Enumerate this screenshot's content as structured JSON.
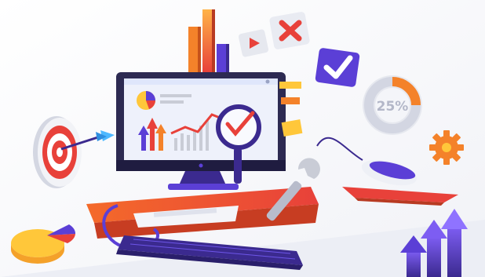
{
  "illustration": {
    "subject": "digital-marketing-analytics",
    "donut_label": "25%",
    "donut_fill_fraction": 0.25,
    "icons": [
      "target-icon",
      "arrow-icon",
      "monitor-icon",
      "magnifier-icon",
      "bar-chart-icon",
      "pie-chart-icon",
      "line-chart-icon",
      "play-icon",
      "close-icon",
      "checkmark-icon",
      "gear-icon",
      "mouse-icon",
      "keyboard-icon",
      "wrench-icon",
      "growth-arrows-icon",
      "sticky-note-icon",
      "donut-chart-icon",
      "desk-icon"
    ]
  },
  "colors": {
    "purple": "#5b3fd6",
    "dark_purple": "#3b2a8f",
    "orange": "#f4822a",
    "red": "#e8413a",
    "yellow": "#ffc73a",
    "light_blue": "#dfe6fb",
    "gray": "#c9ccd6"
  }
}
